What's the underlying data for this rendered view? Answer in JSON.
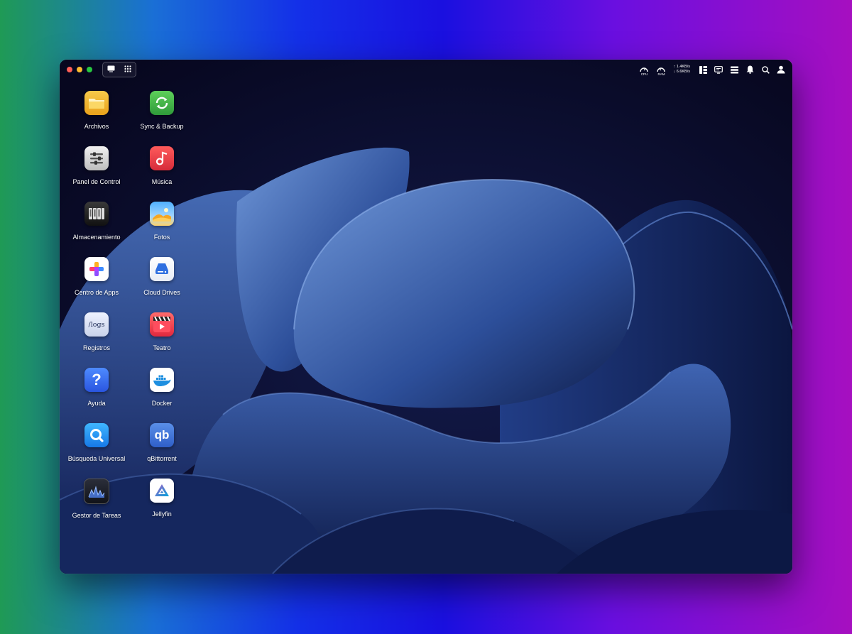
{
  "colors": {
    "accent": "#2f6fe0",
    "close": "#ff5f57",
    "minimize": "#febc2e",
    "maximize": "#28c840"
  },
  "status_bar": {
    "cpu_label": "CPU",
    "ram_label": "RAM",
    "upload": "↑ 1.4KB/s",
    "download": "↓ 6.6KB/s",
    "icons": [
      "widgets-icon",
      "monitor-icon",
      "tasks-icon",
      "bell-icon",
      "search-icon",
      "user-icon"
    ]
  },
  "desktop": {
    "apps": [
      {
        "label": "Archivos",
        "icon": "folder-icon"
      },
      {
        "label": "Sync & Backup",
        "icon": "sync-icon"
      },
      {
        "label": "Panel de Control",
        "icon": "control-panel-icon"
      },
      {
        "label": "Música",
        "icon": "music-icon"
      },
      {
        "label": "Almacenamiento",
        "icon": "storage-icon"
      },
      {
        "label": "Fotos",
        "icon": "photos-icon"
      },
      {
        "label": "Centro de Apps",
        "icon": "app-center-icon"
      },
      {
        "label": "Cloud Drives",
        "icon": "cloud-drives-icon"
      },
      {
        "label": "Registros",
        "icon": "logs-icon",
        "icon_text": "/logs"
      },
      {
        "label": "Teatro",
        "icon": "theater-icon"
      },
      {
        "label": "Ayuda",
        "icon": "help-icon",
        "icon_text": "?"
      },
      {
        "label": "Docker",
        "icon": "docker-icon"
      },
      {
        "label": "Búsqueda Universal",
        "icon": "universal-search-icon"
      },
      {
        "label": "qBittorrent",
        "icon": "qbittorrent-icon",
        "icon_text": "qb"
      },
      {
        "label": "Gestor de Tareas",
        "icon": "task-manager-icon"
      },
      {
        "label": "Jellyfin",
        "icon": "jellyfin-icon"
      }
    ]
  }
}
